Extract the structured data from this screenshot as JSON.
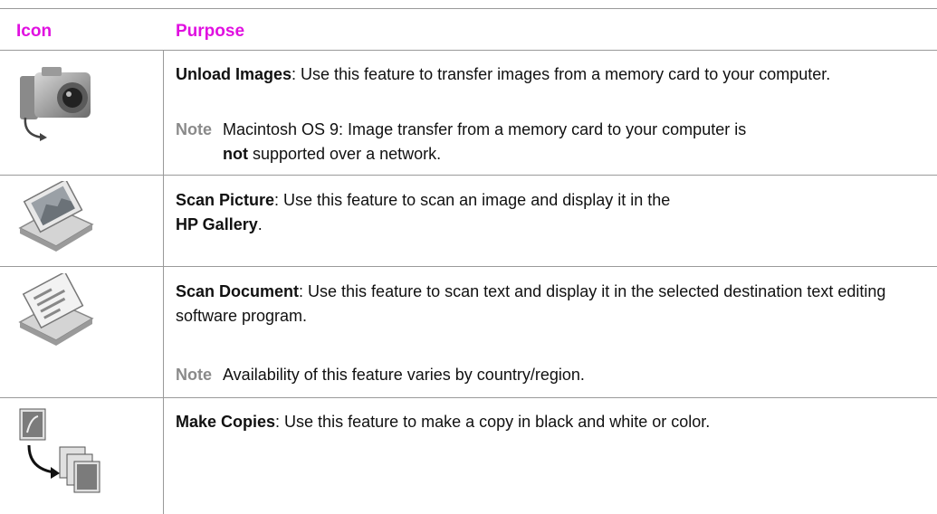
{
  "table": {
    "headers": {
      "icon": "Icon",
      "purpose": "Purpose"
    },
    "rows": [
      {
        "icon": "camera-unload-icon",
        "title": "Unload Images",
        "description": ": Use this feature to transfer images from a memory card to your computer.",
        "note_label": "Note",
        "note_text_1": "Macintosh OS 9: Image transfer from a memory card to your computer is",
        "note_bold": "not",
        "note_text_2": " supported over a network."
      },
      {
        "icon": "scan-picture-icon",
        "title": "Scan Picture",
        "description_1": ": Use this feature to scan an image and display it in the",
        "description_bold": "HP Gallery",
        "description_2": "."
      },
      {
        "icon": "scan-document-icon",
        "title": "Scan Document",
        "description": ": Use this feature to scan text and display it in the selected destination text editing software program.",
        "note_label": "Note",
        "note_text": "Availability of this feature varies by country/region."
      },
      {
        "icon": "make-copies-icon",
        "title": "Make Copies",
        "description": ": Use this feature to make a copy in black and white or color."
      }
    ]
  }
}
